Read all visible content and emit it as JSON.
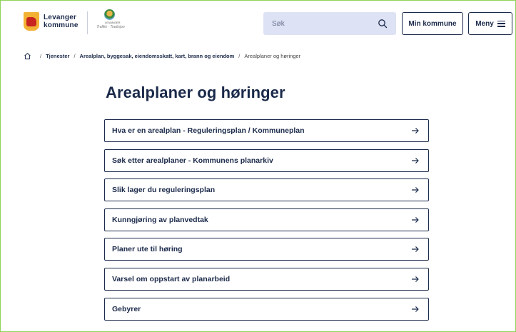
{
  "header": {
    "logo_line1": "Levanger",
    "logo_line2": "kommune",
    "emblem_caption": "LEVANGER",
    "emblem_tagline": "Trafikk · Tradisjon",
    "search": {
      "placeholder": "Søk"
    },
    "min_kommune_label": "Min kommune",
    "menu_label": "Meny"
  },
  "breadcrumb": {
    "items": [
      "Tjenester",
      "Arealplan, byggesak, eiendomsskatt, kart, brann og eiendom"
    ],
    "current": "Arealplaner og høringer"
  },
  "main": {
    "title": "Arealplaner og høringer",
    "links": [
      {
        "label": "Hva er en arealplan - Reguleringsplan / Kommuneplan"
      },
      {
        "label": "Søk etter arealplaner - Kommunens planarkiv"
      },
      {
        "label": "Slik lager du reguleringsplan"
      },
      {
        "label": "Kunngjøring av planvedtak"
      },
      {
        "label": "Planer ute til høring"
      },
      {
        "label": "Varsel om oppstart av planarbeid"
      },
      {
        "label": "Gebyrer"
      }
    ]
  },
  "colors": {
    "primary": "#1b2a4a",
    "search_bg": "#dde2f4",
    "frame_border": "#8fd35a",
    "logo_yellow": "#f2b233",
    "logo_red": "#c8241f"
  },
  "icons": {
    "home": "home-icon",
    "search": "search-icon",
    "menu": "hamburger-menu-icon",
    "link_arrow": "arrow-right-icon"
  }
}
